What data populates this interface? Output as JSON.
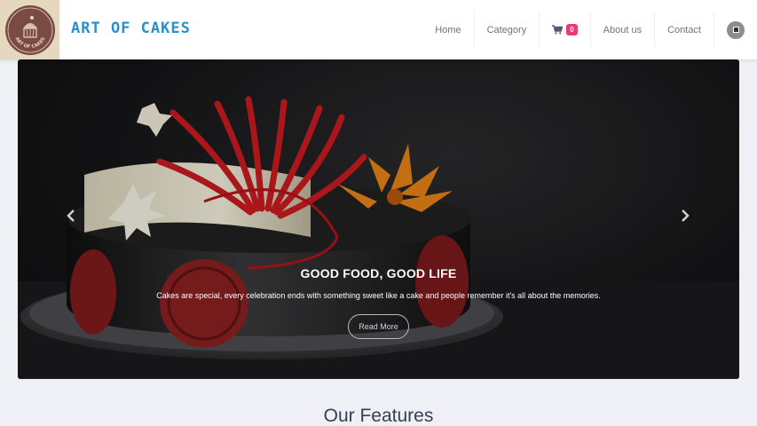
{
  "brand": {
    "name": "ART OF CAKES",
    "logo_text": "ART OF CAKES"
  },
  "nav": {
    "items": [
      "Home",
      "Category"
    ],
    "cart": {
      "icon": "cart-icon",
      "count": "0"
    },
    "items_after": [
      "About us",
      "Contact"
    ],
    "avatar": "user-avatar"
  },
  "hero": {
    "title": "GOOD FOOD, GOOD LIFE",
    "subtitle": "Cakes are special, every celebration ends with something sweet like a cake and people remember it's all about the memories.",
    "button": "Read More",
    "prev_icon": "chevron-left-icon",
    "next_icon": "chevron-right-icon"
  },
  "features": {
    "title": "Our Features"
  },
  "colors": {
    "brand": "#2b8fcf",
    "badge": "#e93a76",
    "nav_text": "#6f7380",
    "heading": "#3b3d52"
  }
}
